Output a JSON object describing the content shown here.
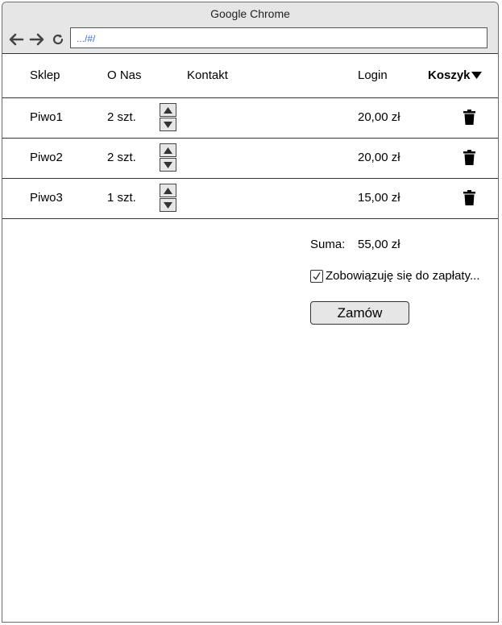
{
  "browser": {
    "title": "Google Chrome",
    "url": ".../#/"
  },
  "menu": {
    "shop": "Sklep",
    "about": "O Nas",
    "contact": "Kontakt",
    "login": "Login",
    "cart": "Koszyk"
  },
  "cart": {
    "items": [
      {
        "name": "Piwo1",
        "qty": "2 szt.",
        "price": "20,00 zł"
      },
      {
        "name": "Piwo2",
        "qty": "2 szt.",
        "price": "20,00 zł"
      },
      {
        "name": "Piwo3",
        "qty": "1 szt.",
        "price": "15,00 zł"
      }
    ],
    "sum_label": "Suma:",
    "sum_value": "55,00 zł",
    "agree_label": "Zobowiązuję się do zapłaty...",
    "agree_checked": true,
    "order_label": "Zamów"
  }
}
